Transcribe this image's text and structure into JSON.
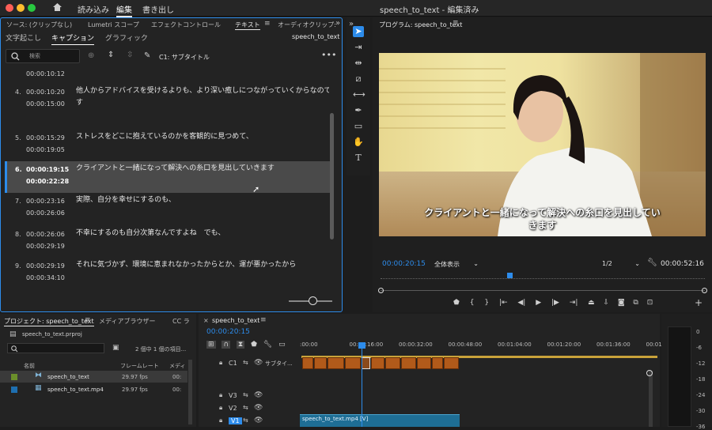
{
  "window": {
    "title": "speech_to_text - 編集済み",
    "menus": [
      "読み込み",
      "編集",
      "書き出し"
    ],
    "selected_menu": "編集"
  },
  "left": {
    "tabs": [
      "ソース: (クリップなし)",
      "Lumetri スコープ",
      "エフェクトコントロール",
      "テキスト",
      "オーディオクリップ:"
    ],
    "subtabs": [
      "文字起こし",
      "キャプション",
      "グラフィック"
    ],
    "active_subtab": "キャプション",
    "seq": "speech_to_text",
    "search_placeholder": "検索",
    "track_label": "C1: サブタイトル",
    "top_time": "00:00:10:12",
    "rows": [
      {
        "num": "4.",
        "in": "00:00:10:20",
        "out": "00:00:15:00",
        "text": "他人からアドバイスを受けるよりも、より深い癒しにつながっていくからなので",
        "text2": "す"
      },
      {
        "num": "5.",
        "in": "00:00:15:29",
        "out": "00:00:19:05",
        "text": "ストレスをどこに抱えているのかを客観的に見つめて、",
        "text2": ""
      },
      {
        "num": "6.",
        "in": "00:00:19:15",
        "out": "00:00:22:28",
        "text": "クライアントと一緒になって解決への糸口を見出していきます",
        "text2": ""
      },
      {
        "num": "7.",
        "in": "00:00:23:16",
        "out": "00:00:26:06",
        "text": "実際、自分を幸せにするのも、",
        "text2": ""
      },
      {
        "num": "8.",
        "in": "00:00:26:06",
        "out": "00:00:29:19",
        "text": "不幸にするのも自分次第なんですよね　でも、",
        "text2": ""
      },
      {
        "num": "9.",
        "in": "00:00:29:19",
        "out": "00:00:34:10",
        "text": "それに気づかず、環境に恵まれなかったからとか、運が悪かったから",
        "text2": ""
      }
    ]
  },
  "program": {
    "title": "プログラム: speech_to_text",
    "caption1": "クライアントと一緒になって解決への糸口を見出してい",
    "caption2": "きます",
    "timecode": "00:00:20:15",
    "fit": "全体表示",
    "res": "1/2",
    "duration": "00:00:52:16",
    "playhead_fraction": 0.39
  },
  "project": {
    "tabs": [
      "プロジェクト: speech_to_text",
      "メディアブラウザー",
      "CC ラ"
    ],
    "file": "speech_to_text.prproj",
    "count": "2 個中 1 個の項目...",
    "cols": [
      "名前",
      "フレームレート",
      "メディ"
    ],
    "items": [
      {
        "name": "speech_to_text",
        "fps": "29.97 fps",
        "extra": "00:"
      },
      {
        "name": "speech_to_text.mp4",
        "fps": "29.97 fps",
        "extra": "00:"
      }
    ]
  },
  "timeline": {
    "tab": "speech_to_text",
    "timecode": "00:00:20:15",
    "ruler": [
      ":00:00",
      "00:00:16:00",
      "00:00:32:00",
      "00:00:48:00",
      "00:01:04:00",
      "00:01:20:00",
      "00:01:36:00",
      "00:01:5"
    ],
    "tracks": [
      "C1",
      "V3",
      "V2",
      "V1"
    ],
    "c1_label": "サブタイ...",
    "clip": "speech_to_text.mp4 [V]"
  },
  "meter": {
    "labels": [
      "0",
      "-6",
      "-12",
      "-18",
      "-24",
      "-30",
      "-36"
    ]
  }
}
